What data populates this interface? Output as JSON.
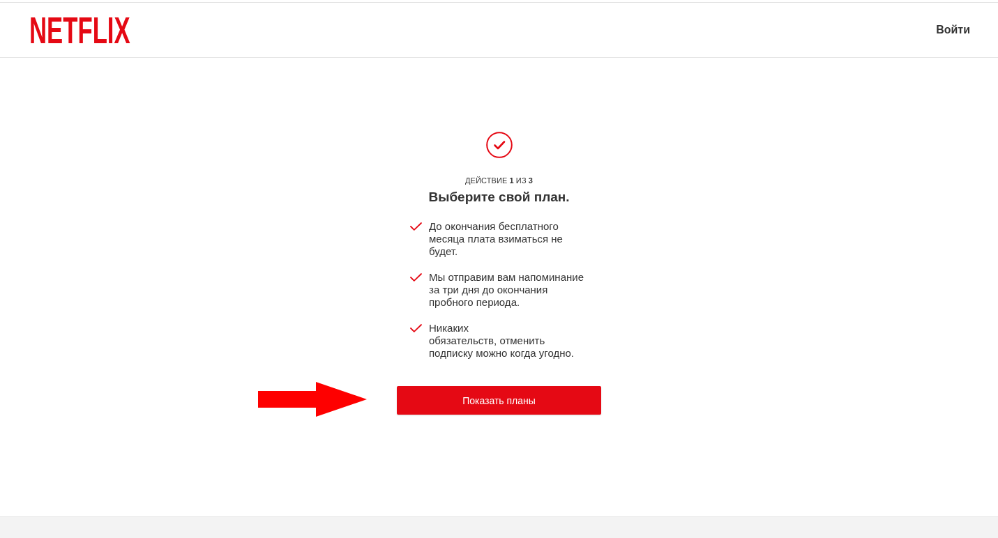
{
  "header": {
    "logo": "NETFLIX",
    "sign_in": "Войти"
  },
  "step": {
    "progress": "ДЕЙСТВИЕ **1** ИЗ **3**",
    "title": "Выберите свой план."
  },
  "benefits": [
    "До окончания бесплатного месяца плата взиматься не будет.",
    "Мы отправим вам напоминание за три дня до окончания пробного периода.",
    "Никаких\nобязательств, отменить подписку можно когда угодно."
  ],
  "button": {
    "label": "Показать планы"
  }
}
